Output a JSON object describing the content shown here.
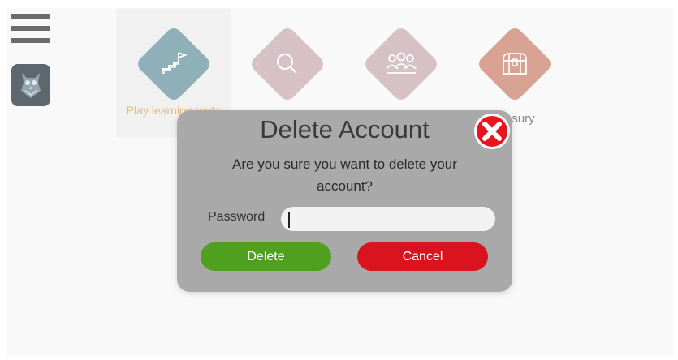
{
  "nav": {
    "menu_icon": "hamburger-icon",
    "avatar_icon": "owl-avatar-icon"
  },
  "tiles": [
    {
      "label": "Play learning route",
      "icon": "route-flag-icon",
      "color": "#8fb0b8"
    },
    {
      "label": "",
      "icon": "search-icon",
      "color": "#d6c2c6"
    },
    {
      "label": "",
      "icon": "group-icon",
      "color": "#d6c2c6"
    },
    {
      "label": "asury",
      "icon": "treasure-chest-icon",
      "color": "#d9a393"
    }
  ],
  "modal": {
    "title": "Delete Account",
    "message": "Are you sure you want to delete your account?",
    "password_label": "Password",
    "password_value": "",
    "delete_label": "Delete",
    "cancel_label": "Cancel",
    "close_icon": "close-icon"
  },
  "colors": {
    "modal_bg": "#a9a9a9",
    "delete": "#4fa01e",
    "cancel": "#d9141e",
    "close": "#e8141e"
  }
}
